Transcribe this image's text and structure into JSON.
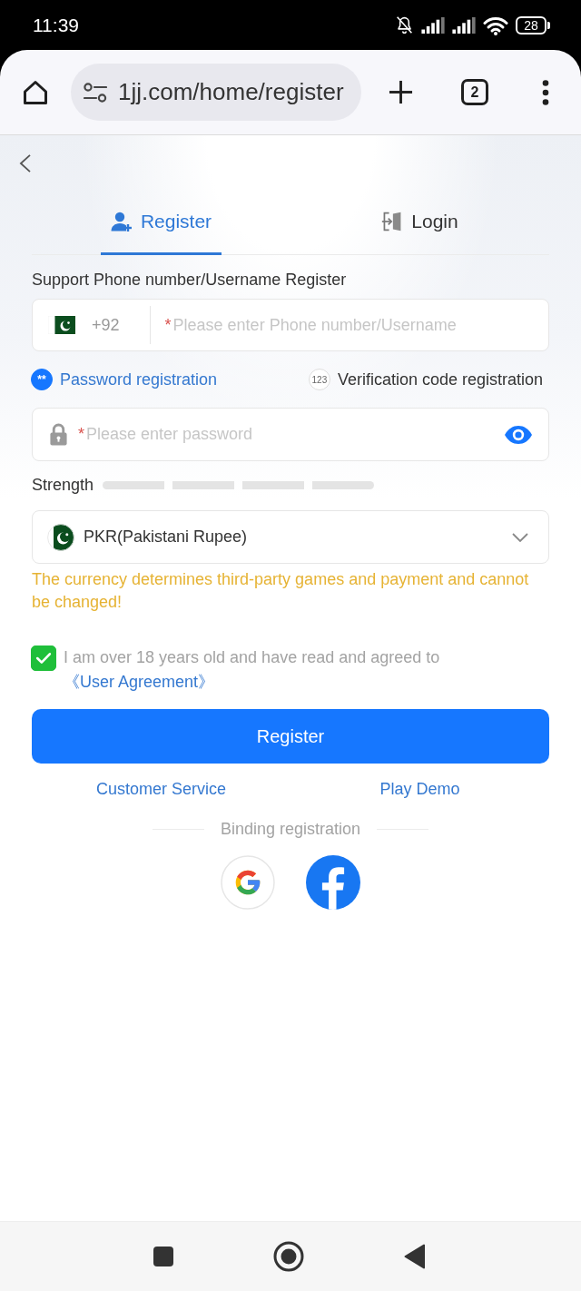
{
  "status_bar": {
    "time": "11:39",
    "battery": "28"
  },
  "browser": {
    "url": "1jj.com/home/register",
    "tab_count": "2"
  },
  "tabs": [
    {
      "kind": "register",
      "label": "Register",
      "selected": true
    },
    {
      "kind": "login",
      "label": "Login",
      "selected": false
    }
  ],
  "phone": {
    "heading": "Support Phone number/Username Register",
    "country_code": "+92",
    "required_mark": "*",
    "placeholder": "Please enter Phone number/Username"
  },
  "modes": [
    {
      "badge": "**",
      "label": "Password registration",
      "selected": true
    },
    {
      "badge": "123",
      "label": "Verification code registration",
      "selected": false
    }
  ],
  "password": {
    "required_mark": "*",
    "placeholder": "Please enter password"
  },
  "strength": {
    "label": "Strength",
    "level": 0
  },
  "currency": {
    "value": "PKR(Pakistani Rupee)",
    "notice": "The currency determines third-party games and payment and cannot be changed!"
  },
  "agreement": {
    "checked": true,
    "text": "I am over 18 years old and have read and agreed to",
    "link": "《User Agreement》"
  },
  "submit": {
    "label": "Register"
  },
  "links": [
    "Customer Service",
    "Play Demo"
  ],
  "binding": {
    "title": "Binding registration",
    "providers": [
      {
        "kind": "google"
      },
      {
        "kind": "facebook"
      }
    ]
  }
}
